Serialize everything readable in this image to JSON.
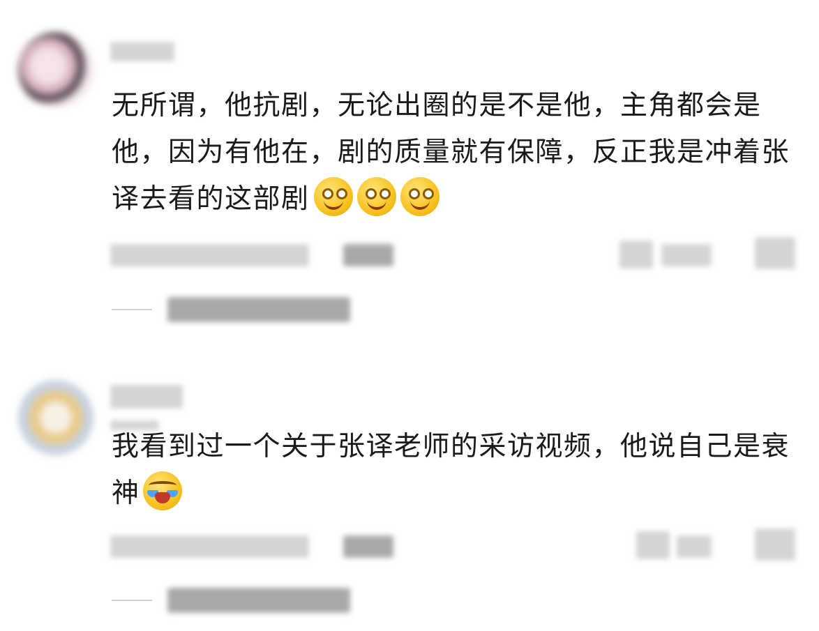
{
  "comments": [
    {
      "text": "无所谓，他抗剧，无论出圈的是不是他，主角都会是他，因为有他在，剧的质量就有保障，反正我是冲着张译去看的这部剧",
      "emojis": [
        "grin-emoji",
        "grin-emoji",
        "grin-emoji"
      ]
    },
    {
      "text": "我看到过一个关于张译老师的采访视频，他说自己是衰神",
      "emojis": [
        "laugh-cry-emoji"
      ]
    }
  ]
}
